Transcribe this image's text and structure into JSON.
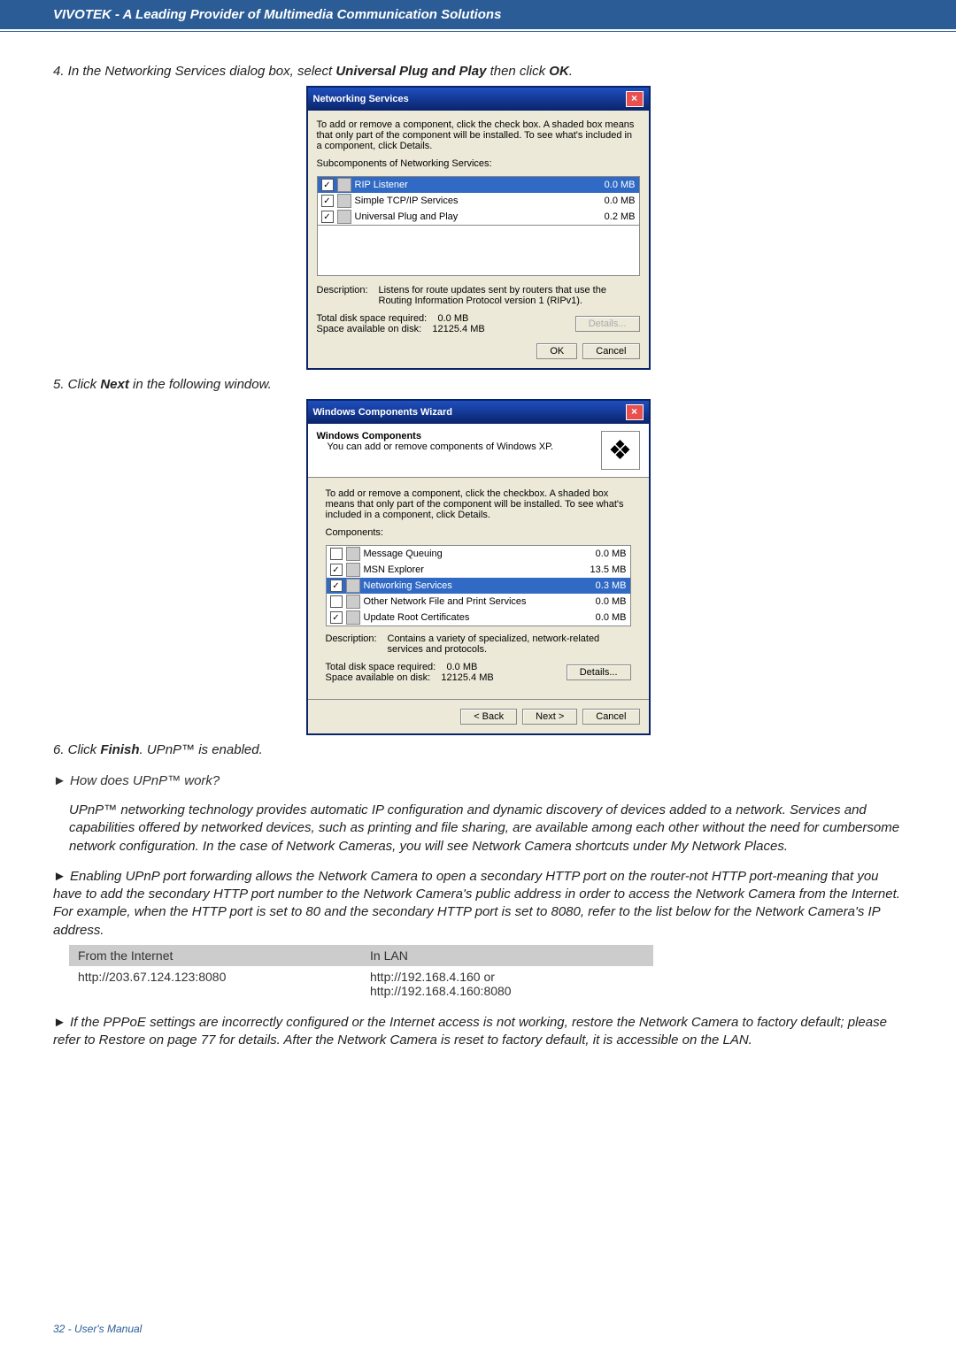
{
  "header": {
    "title": "VIVOTEK - A Leading Provider of Multimedia Communication Solutions"
  },
  "step4": {
    "prefix": "4. In the Networking Services dialog box, select ",
    "bold1": "Universal Plug and Play",
    "mid": " then click ",
    "bold2": "OK",
    "suffix": "."
  },
  "dlg1": {
    "title": "Networking Services",
    "intro": "To add or remove a component, click the check box. A shaded box means that only part of the component will be installed. To see what's included in a component, click Details.",
    "sublabel": "Subcomponents of Networking Services:",
    "items": [
      {
        "checked": true,
        "selected": true,
        "label": "RIP Listener",
        "size": "0.0 MB"
      },
      {
        "checked": true,
        "selected": false,
        "label": "Simple TCP/IP Services",
        "size": "0.0 MB"
      },
      {
        "checked": true,
        "selected": false,
        "label": "Universal Plug and Play",
        "size": "0.2 MB"
      }
    ],
    "desc_label": "Description:",
    "desc_text": "Listens for route updates sent by routers that use the Routing Information Protocol version 1 (RIPv1).",
    "req_label": "Total disk space required:",
    "req_val": "0.0 MB",
    "avail_label": "Space available on disk:",
    "avail_val": "12125.4 MB",
    "details_btn": "Details...",
    "ok": "OK",
    "cancel": "Cancel"
  },
  "step5": {
    "prefix": "5. Click ",
    "bold1": "Next",
    "suffix": " in the following window."
  },
  "dlg2": {
    "title": "Windows Components Wizard",
    "top_title": "Windows Components",
    "top_sub": "You can add or remove components of Windows XP.",
    "intro": "To add or remove a component, click the checkbox. A shaded box means that only part of the component will be installed. To see what's included in a component, click Details.",
    "complabel": "Components:",
    "items": [
      {
        "checked": false,
        "selected": false,
        "label": "Message Queuing",
        "size": "0.0 MB"
      },
      {
        "checked": true,
        "selected": false,
        "label": "MSN Explorer",
        "size": "13.5 MB"
      },
      {
        "checked": true,
        "selected": true,
        "label": "Networking Services",
        "size": "0.3 MB"
      },
      {
        "checked": false,
        "selected": false,
        "label": "Other Network File and Print Services",
        "size": "0.0 MB"
      },
      {
        "checked": true,
        "selected": false,
        "label": "Update Root Certificates",
        "size": "0.0 MB"
      }
    ],
    "desc_label": "Description:",
    "desc_text": "Contains a variety of specialized, network-related services and protocols.",
    "req_label": "Total disk space required:",
    "req_val": "0.0 MB",
    "avail_label": "Space available on disk:",
    "avail_val": "12125.4 MB",
    "details_btn": "Details...",
    "back": "< Back",
    "next": "Next >",
    "cancel": "Cancel"
  },
  "step6": {
    "prefix": "6. Click ",
    "bold1": "Finish",
    "suffix": ". UPnP™ is enabled."
  },
  "q1": {
    "heading": "► How does UPnP™ work?",
    "body": "UPnP™ networking technology provides automatic IP configuration and dynamic discovery of devices added to a network. Services and capabilities offered by networked devices, such as printing and file sharing, are available among each other without the need for cumbersome network configuration. In the case of Network Cameras, you will see Network Camera shortcuts under My Network Places."
  },
  "q2": {
    "body": "► Enabling UPnP port forwarding allows the Network Camera to open a secondary HTTP port on the router-not HTTP port-meaning that you have to add the secondary HTTP port number to the Network Camera's public address in order to access the Network Camera from the Internet. For example, when the HTTP port is set to 80 and the secondary HTTP port is set to 8080, refer to the list below for the Network Camera's IP address."
  },
  "table": {
    "h1": "From the Internet",
    "h2": "In LAN",
    "r1c1": "http://203.67.124.123:8080",
    "r1c2": "http://192.168.4.160 or\nhttp://192.168.4.160:8080"
  },
  "q3": {
    "body": "► If the PPPoE settings are incorrectly configured or the Internet access is not working, restore the Network Camera to factory default; please refer to Restore on page 77 for details. After the Network Camera is reset to factory default, it is accessible on the LAN."
  },
  "footer": {
    "text": "32 - User's Manual"
  }
}
